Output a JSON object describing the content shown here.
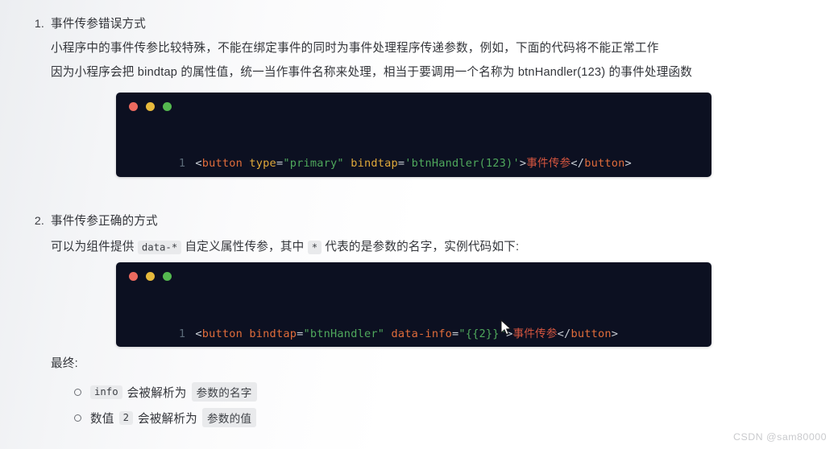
{
  "sections": [
    {
      "marker": "1.",
      "heading": "事件传参错误方式",
      "paragraphs": [
        "小程序中的事件传参比较特殊，不能在绑定事件的同时为事件处理程序传递参数，例如，下面的代码将不能正常工作",
        "因为小程序会把 bindtap 的属性值，统一当作事件名称来处理，相当于要调用一个名称为 btnHandler(123) 的事件处理函数"
      ]
    },
    {
      "marker": "2.",
      "heading": "事件传参正确的方式"
    }
  ],
  "section2_sentence": {
    "part1": "可以为组件提供 ",
    "code1": "data-*",
    "part2": " 自定义属性传参，其中 ",
    "code2": "*",
    "part3": " 代表的是参数的名字，实例代码如下:"
  },
  "code_block_1": {
    "dots": [
      "red-dot",
      "yellow-dot",
      "green-dot"
    ],
    "line_number": "1",
    "tokens": [
      {
        "text": "<",
        "kind": "punct"
      },
      {
        "text": "button",
        "kind": "tag"
      },
      {
        "text": " ",
        "kind": "punct"
      },
      {
        "text": "type",
        "kind": "attr"
      },
      {
        "text": "=",
        "kind": "punct"
      },
      {
        "text": "\"primary\"",
        "kind": "string"
      },
      {
        "text": " ",
        "kind": "punct"
      },
      {
        "text": "bindtap",
        "kind": "attr"
      },
      {
        "text": "=",
        "kind": "punct"
      },
      {
        "text": "'btnHandler(123)'",
        "kind": "string"
      },
      {
        "text": ">",
        "kind": "punct"
      },
      {
        "text": "事件传参",
        "kind": "chinese"
      },
      {
        "text": "</",
        "kind": "punct"
      },
      {
        "text": "button",
        "kind": "tag"
      },
      {
        "text": ">",
        "kind": "punct"
      }
    ],
    "plain_text": "<button type=\"primary\" bindtap='btnHandler(123)'>事件传参</button>"
  },
  "code_block_2": {
    "dots": [
      "red-dot",
      "yellow-dot",
      "green-dot"
    ],
    "line_number": "1",
    "tokens": [
      {
        "text": "<",
        "kind": "punct"
      },
      {
        "text": "button",
        "kind": "tag"
      },
      {
        "text": " ",
        "kind": "punct"
      },
      {
        "text": "bindtap",
        "kind": "attr2"
      },
      {
        "text": "=",
        "kind": "punct"
      },
      {
        "text": "\"btnHandler\"",
        "kind": "string"
      },
      {
        "text": " ",
        "kind": "punct"
      },
      {
        "text": "data-info",
        "kind": "attr2"
      },
      {
        "text": "=",
        "kind": "punct"
      },
      {
        "text": "\"{{2}}\"",
        "kind": "string"
      },
      {
        "text": ">",
        "kind": "punct"
      },
      {
        "text": "事件传参",
        "kind": "chinese"
      },
      {
        "text": "</",
        "kind": "punct"
      },
      {
        "text": "button",
        "kind": "tag"
      },
      {
        "text": ">",
        "kind": "punct"
      }
    ],
    "plain_text": "<button bindtap=\"btnHandler\" data-info=\"{{2}}\">事件传参</button>"
  },
  "final": {
    "label": "最终:",
    "bullets": [
      {
        "code": "info",
        "middle": "会被解析为",
        "highlight": "参数的名字",
        "prefix": ""
      },
      {
        "code": "2",
        "middle": "会被解析为",
        "highlight": "参数的值",
        "prefix": "数值"
      }
    ]
  },
  "watermark": "CSDN @sam80000",
  "colors": {
    "page_bg": "#ffffff",
    "code_bg": "#0c1021",
    "dot_red": "#ec6a5f",
    "dot_yellow": "#e6b93c",
    "dot_green": "#54b84f",
    "token_tag": "#e06c3a",
    "token_attr": "#e0a93a",
    "token_string": "#4fa85c",
    "token_chinese": "#d4553f",
    "token_punct": "#c8cdd4",
    "line_number": "#5b6a78",
    "chip_bg": "#e9eaec",
    "text": "#33353a",
    "watermark": "#c9cacd"
  }
}
